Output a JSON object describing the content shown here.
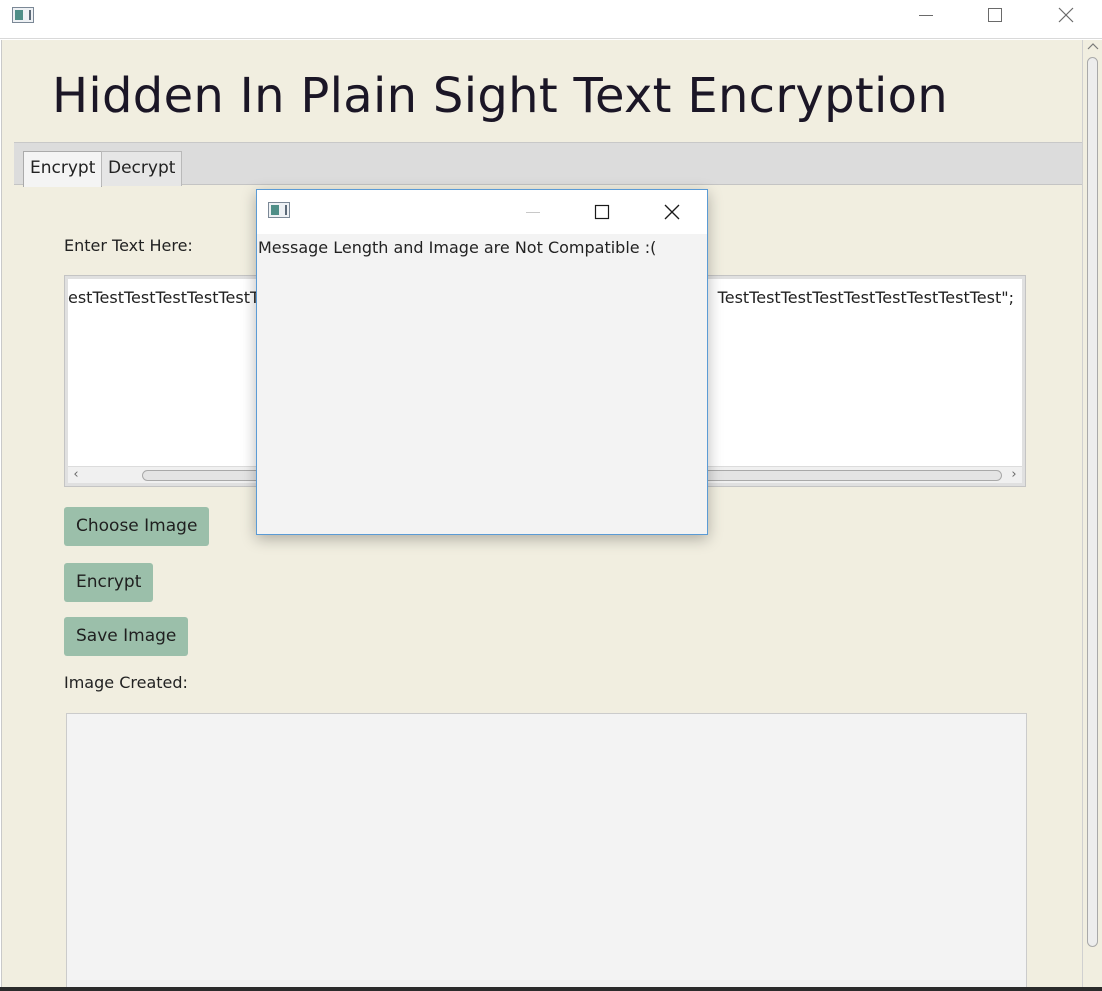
{
  "window": {
    "icon": "app-window-icon",
    "controls": [
      "minimize-icon",
      "maximize-icon",
      "close-icon"
    ]
  },
  "app": {
    "title": "Hidden In Plain Sight Text Encryption"
  },
  "tabs": [
    {
      "label": "Encrypt",
      "selected": true
    },
    {
      "label": "Decrypt",
      "selected": false
    }
  ],
  "encrypt_tab": {
    "input_label": "Enter Text Here:",
    "input_text_left": "estTestTestTestTestTestT",
    "input_text_right": "TestTestTestTestTestTestTestTestTest\";",
    "choose_image_label": "Choose Image",
    "encrypt_label": "Encrypt",
    "save_image_label": "Save Image",
    "image_created_label": "Image Created:"
  },
  "dialog": {
    "icon": "app-window-icon",
    "message": "Message Length and Image are Not Compatible :("
  },
  "colors": {
    "background": "#f1eee0",
    "button": "#9bbfaa",
    "dialog_border": "#5b9bd5"
  }
}
